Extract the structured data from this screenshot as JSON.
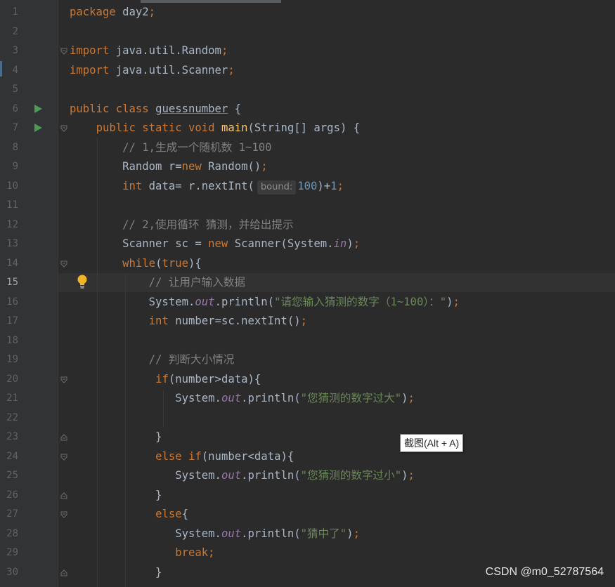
{
  "editor": {
    "current_line": 15,
    "lines": [
      {
        "n": "1",
        "c": [
          {
            "t": "package ",
            "k": "kw"
          },
          {
            "t": "day2"
          },
          {
            "t": ";",
            "k": "kw"
          }
        ]
      },
      {
        "n": "2",
        "c": []
      },
      {
        "n": "3",
        "c": [
          {
            "t": "import ",
            "k": "kw"
          },
          {
            "t": "java.util.Random"
          },
          {
            "t": ";",
            "k": "kw"
          }
        ]
      },
      {
        "n": "4",
        "c": [
          {
            "t": "import ",
            "k": "kw"
          },
          {
            "t": "java.util.Scanner"
          },
          {
            "t": ";",
            "k": "kw"
          }
        ]
      },
      {
        "n": "5",
        "c": []
      },
      {
        "n": "6",
        "c": [
          {
            "t": "public class ",
            "k": "kw"
          },
          {
            "t": "guessnumber",
            "k": "uline"
          },
          {
            "t": " {"
          }
        ]
      },
      {
        "n": "7",
        "c": [
          {
            "t": "    "
          },
          {
            "t": "public static void ",
            "k": "kw"
          },
          {
            "t": "main",
            "k": "fn"
          },
          {
            "t": "(String[] args) {"
          }
        ]
      },
      {
        "n": "8",
        "c": [
          {
            "t": "        "
          },
          {
            "t": "// 1,生成一个随机数 1~100",
            "k": "cmt"
          }
        ]
      },
      {
        "n": "9",
        "c": [
          {
            "t": "        Random r="
          },
          {
            "t": "new ",
            "k": "kw"
          },
          {
            "t": "Random()"
          },
          {
            "t": ";",
            "k": "kw"
          }
        ]
      },
      {
        "n": "10",
        "c": [
          {
            "t": "        "
          },
          {
            "t": "int ",
            "k": "kw"
          },
          {
            "t": "data= r.nextInt("
          },
          {
            "t": "bound:",
            "k": "hint"
          },
          {
            "t": "100",
            "k": "num"
          },
          {
            "t": ")+"
          },
          {
            "t": "1",
            "k": "num"
          },
          {
            "t": ";",
            "k": "kw"
          }
        ]
      },
      {
        "n": "11",
        "c": []
      },
      {
        "n": "12",
        "c": [
          {
            "t": "        "
          },
          {
            "t": "// 2,使用循环 猜测，并给出提示",
            "k": "cmt"
          }
        ]
      },
      {
        "n": "13",
        "c": [
          {
            "t": "        Scanner sc = "
          },
          {
            "t": "new ",
            "k": "kw"
          },
          {
            "t": "Scanner(System."
          },
          {
            "t": "in",
            "k": "fld"
          },
          {
            "t": ")"
          },
          {
            "t": ";",
            "k": "kw"
          }
        ]
      },
      {
        "n": "14",
        "c": [
          {
            "t": "        "
          },
          {
            "t": "while",
            "k": "kw"
          },
          {
            "t": "("
          },
          {
            "t": "true",
            "k": "kw"
          },
          {
            "t": "){"
          }
        ]
      },
      {
        "n": "15",
        "c": [
          {
            "t": "            "
          },
          {
            "t": "// 让用户输入数据",
            "k": "cmt"
          }
        ]
      },
      {
        "n": "16",
        "c": [
          {
            "t": "            System."
          },
          {
            "t": "out",
            "k": "fld"
          },
          {
            "t": ".println("
          },
          {
            "t": "\"请您输入猜测的数字（1~100）：\"",
            "k": "str"
          },
          {
            "t": ")"
          },
          {
            "t": ";",
            "k": "kw"
          }
        ]
      },
      {
        "n": "17",
        "c": [
          {
            "t": "            "
          },
          {
            "t": "int ",
            "k": "kw"
          },
          {
            "t": "number=sc.nextInt()"
          },
          {
            "t": ";",
            "k": "kw"
          }
        ]
      },
      {
        "n": "18",
        "c": []
      },
      {
        "n": "19",
        "c": [
          {
            "t": "            "
          },
          {
            "t": "// 判断大小情况",
            "k": "cmt"
          }
        ]
      },
      {
        "n": "20",
        "c": [
          {
            "t": "             "
          },
          {
            "t": "if",
            "k": "kw"
          },
          {
            "t": "(number>data){"
          }
        ]
      },
      {
        "n": "21",
        "c": [
          {
            "t": "                System."
          },
          {
            "t": "out",
            "k": "fld"
          },
          {
            "t": ".println("
          },
          {
            "t": "\"您猜测的数字过大\"",
            "k": "str"
          },
          {
            "t": ")"
          },
          {
            "t": ";",
            "k": "kw"
          }
        ]
      },
      {
        "n": "22",
        "c": []
      },
      {
        "n": "23",
        "c": [
          {
            "t": "             }"
          }
        ]
      },
      {
        "n": "24",
        "c": [
          {
            "t": "             "
          },
          {
            "t": "else if",
            "k": "kw"
          },
          {
            "t": "(number<data){"
          }
        ]
      },
      {
        "n": "25",
        "c": [
          {
            "t": "                System."
          },
          {
            "t": "out",
            "k": "fld"
          },
          {
            "t": ".println("
          },
          {
            "t": "\"您猜测的数字过小\"",
            "k": "str"
          },
          {
            "t": ")"
          },
          {
            "t": ";",
            "k": "kw"
          }
        ]
      },
      {
        "n": "26",
        "c": [
          {
            "t": "             }"
          }
        ]
      },
      {
        "n": "27",
        "c": [
          {
            "t": "             "
          },
          {
            "t": "else",
            "k": "kw"
          },
          {
            "t": "{"
          }
        ]
      },
      {
        "n": "28",
        "c": [
          {
            "t": "                System."
          },
          {
            "t": "out",
            "k": "fld"
          },
          {
            "t": ".println("
          },
          {
            "t": "\"猜中了\"",
            "k": "str"
          },
          {
            "t": ")"
          },
          {
            "t": ";",
            "k": "kw"
          }
        ]
      },
      {
        "n": "29",
        "c": [
          {
            "t": "                "
          },
          {
            "t": "break;",
            "k": "kw"
          }
        ]
      },
      {
        "n": "30",
        "c": [
          {
            "t": "             }"
          }
        ]
      }
    ],
    "run_markers": [
      6,
      7
    ],
    "fold_open": [
      3,
      7,
      14,
      20,
      24,
      27
    ],
    "fold_close": [
      23,
      26,
      30
    ]
  },
  "tooltip": {
    "label": "截图(Alt + A)"
  },
  "watermark": {
    "text": "CSDN @m0_52787564"
  },
  "colors": {
    "background": "#2b2b2b",
    "keyword": "#cc7832",
    "string": "#6a8759",
    "number": "#6897bb",
    "comment": "#808080",
    "method": "#ffc66d",
    "run_marker": "#499c54"
  }
}
